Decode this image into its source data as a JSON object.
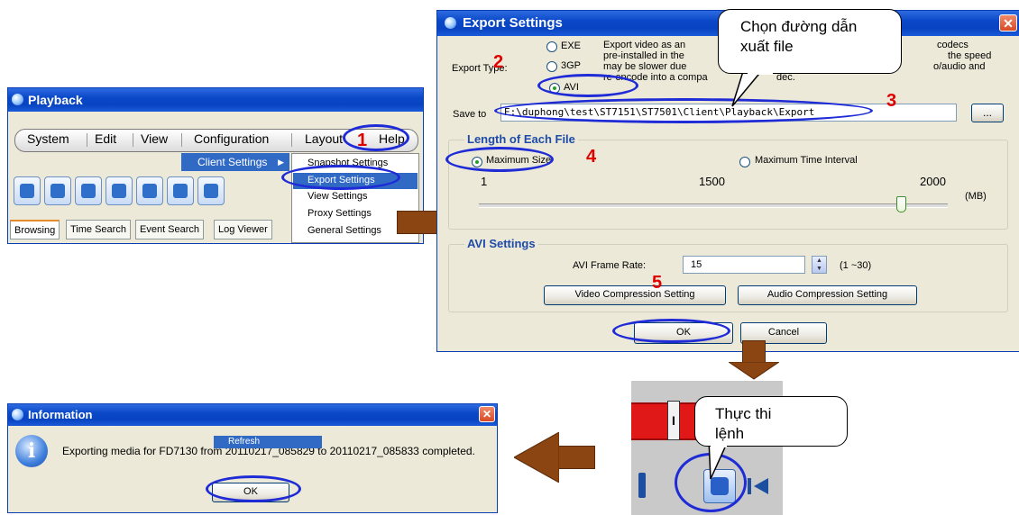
{
  "playback": {
    "title": "Playback",
    "menu": [
      "System",
      "Edit",
      "View",
      "Configuration",
      "Layout",
      "Help"
    ],
    "tabs": [
      "Browsing",
      "Time Search",
      "Event Search",
      "Log Viewer"
    ],
    "client_settings": "Client Settings",
    "submenu": [
      "Snapshot Settings",
      "Export Settings",
      "View Settings",
      "Proxy Settings",
      "General Settings"
    ]
  },
  "export": {
    "title": "Export Settings",
    "close": "✕",
    "export_type_label": "Export Type:",
    "types": [
      "EXE",
      "3GP",
      "AVI"
    ],
    "selected_type": "AVI",
    "description_lines": [
      "Export video as an",
      "pre-installed in the",
      "may be slower due",
      "re-encode into a compa",
      "codecs",
      "the speed",
      "o/audio and",
      "dec."
    ],
    "save_to_label": "Save to",
    "save_to_value": "E:\\duphong\\test\\ST7151\\ST7501\\Client\\Playback\\Export",
    "browse": "...",
    "length_title": "Length of Each File",
    "opt_max_size": "Maximum Size",
    "opt_max_time": "Maximum Time Interval",
    "scale": [
      "1",
      "1500",
      "2000"
    ],
    "unit": "(MB)",
    "slider_fraction": 0.9,
    "avi_title": "AVI Settings",
    "frame_rate_label": "AVI Frame Rate:",
    "frame_rate_value": "15",
    "frame_rate_range": "(1 ~30)",
    "video_btn": "Video Compression Setting",
    "audio_btn": "Audio Compression Setting",
    "ok": "OK",
    "cancel": "Cancel"
  },
  "callout_path": "Chọn đường dẫn xuất file",
  "callout_exec": "Thực thi",
  "callout_exec_cut": "lệnh",
  "steps": [
    "1",
    "2",
    "3",
    "4",
    "5"
  ],
  "info": {
    "title": "Information",
    "close": "✕",
    "message": "Exporting media for FD7130 from 20110217_085829 to 20110217_085833 completed.",
    "refresh": "Refresh",
    "ok": "OK"
  },
  "toolbar_crop": {
    "label": "I"
  },
  "colors": {
    "annotation_ring": "#1e2bd6",
    "step_number": "#e00000",
    "arrow": "#8b4513",
    "xp_title": "#0a48c8"
  }
}
